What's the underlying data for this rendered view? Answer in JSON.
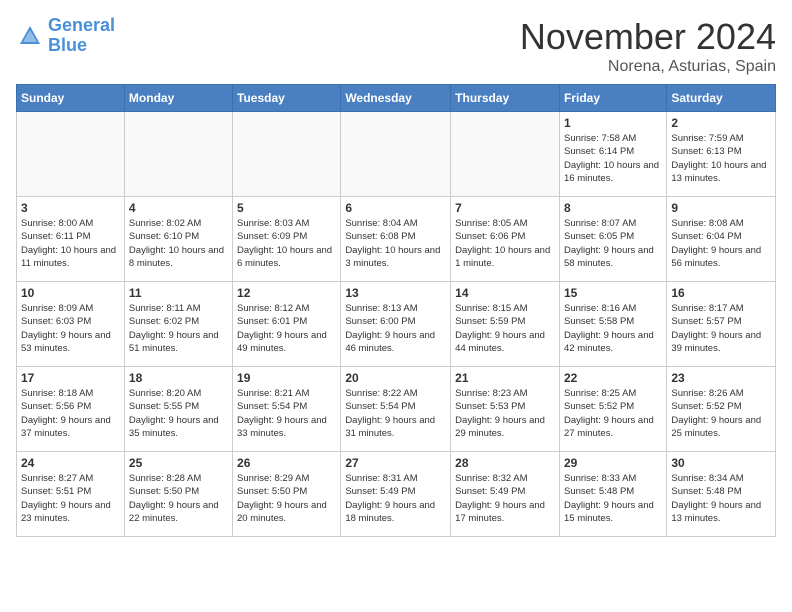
{
  "header": {
    "logo_line1": "General",
    "logo_line2": "Blue",
    "month_title": "November 2024",
    "location": "Norena, Asturias, Spain"
  },
  "weekdays": [
    "Sunday",
    "Monday",
    "Tuesday",
    "Wednesday",
    "Thursday",
    "Friday",
    "Saturday"
  ],
  "weeks": [
    [
      {
        "day": "",
        "info": ""
      },
      {
        "day": "",
        "info": ""
      },
      {
        "day": "",
        "info": ""
      },
      {
        "day": "",
        "info": ""
      },
      {
        "day": "",
        "info": ""
      },
      {
        "day": "1",
        "info": "Sunrise: 7:58 AM\nSunset: 6:14 PM\nDaylight: 10 hours and 16 minutes."
      },
      {
        "day": "2",
        "info": "Sunrise: 7:59 AM\nSunset: 6:13 PM\nDaylight: 10 hours and 13 minutes."
      }
    ],
    [
      {
        "day": "3",
        "info": "Sunrise: 8:00 AM\nSunset: 6:11 PM\nDaylight: 10 hours and 11 minutes."
      },
      {
        "day": "4",
        "info": "Sunrise: 8:02 AM\nSunset: 6:10 PM\nDaylight: 10 hours and 8 minutes."
      },
      {
        "day": "5",
        "info": "Sunrise: 8:03 AM\nSunset: 6:09 PM\nDaylight: 10 hours and 6 minutes."
      },
      {
        "day": "6",
        "info": "Sunrise: 8:04 AM\nSunset: 6:08 PM\nDaylight: 10 hours and 3 minutes."
      },
      {
        "day": "7",
        "info": "Sunrise: 8:05 AM\nSunset: 6:06 PM\nDaylight: 10 hours and 1 minute."
      },
      {
        "day": "8",
        "info": "Sunrise: 8:07 AM\nSunset: 6:05 PM\nDaylight: 9 hours and 58 minutes."
      },
      {
        "day": "9",
        "info": "Sunrise: 8:08 AM\nSunset: 6:04 PM\nDaylight: 9 hours and 56 minutes."
      }
    ],
    [
      {
        "day": "10",
        "info": "Sunrise: 8:09 AM\nSunset: 6:03 PM\nDaylight: 9 hours and 53 minutes."
      },
      {
        "day": "11",
        "info": "Sunrise: 8:11 AM\nSunset: 6:02 PM\nDaylight: 9 hours and 51 minutes."
      },
      {
        "day": "12",
        "info": "Sunrise: 8:12 AM\nSunset: 6:01 PM\nDaylight: 9 hours and 49 minutes."
      },
      {
        "day": "13",
        "info": "Sunrise: 8:13 AM\nSunset: 6:00 PM\nDaylight: 9 hours and 46 minutes."
      },
      {
        "day": "14",
        "info": "Sunrise: 8:15 AM\nSunset: 5:59 PM\nDaylight: 9 hours and 44 minutes."
      },
      {
        "day": "15",
        "info": "Sunrise: 8:16 AM\nSunset: 5:58 PM\nDaylight: 9 hours and 42 minutes."
      },
      {
        "day": "16",
        "info": "Sunrise: 8:17 AM\nSunset: 5:57 PM\nDaylight: 9 hours and 39 minutes."
      }
    ],
    [
      {
        "day": "17",
        "info": "Sunrise: 8:18 AM\nSunset: 5:56 PM\nDaylight: 9 hours and 37 minutes."
      },
      {
        "day": "18",
        "info": "Sunrise: 8:20 AM\nSunset: 5:55 PM\nDaylight: 9 hours and 35 minutes."
      },
      {
        "day": "19",
        "info": "Sunrise: 8:21 AM\nSunset: 5:54 PM\nDaylight: 9 hours and 33 minutes."
      },
      {
        "day": "20",
        "info": "Sunrise: 8:22 AM\nSunset: 5:54 PM\nDaylight: 9 hours and 31 minutes."
      },
      {
        "day": "21",
        "info": "Sunrise: 8:23 AM\nSunset: 5:53 PM\nDaylight: 9 hours and 29 minutes."
      },
      {
        "day": "22",
        "info": "Sunrise: 8:25 AM\nSunset: 5:52 PM\nDaylight: 9 hours and 27 minutes."
      },
      {
        "day": "23",
        "info": "Sunrise: 8:26 AM\nSunset: 5:52 PM\nDaylight: 9 hours and 25 minutes."
      }
    ],
    [
      {
        "day": "24",
        "info": "Sunrise: 8:27 AM\nSunset: 5:51 PM\nDaylight: 9 hours and 23 minutes."
      },
      {
        "day": "25",
        "info": "Sunrise: 8:28 AM\nSunset: 5:50 PM\nDaylight: 9 hours and 22 minutes."
      },
      {
        "day": "26",
        "info": "Sunrise: 8:29 AM\nSunset: 5:50 PM\nDaylight: 9 hours and 20 minutes."
      },
      {
        "day": "27",
        "info": "Sunrise: 8:31 AM\nSunset: 5:49 PM\nDaylight: 9 hours and 18 minutes."
      },
      {
        "day": "28",
        "info": "Sunrise: 8:32 AM\nSunset: 5:49 PM\nDaylight: 9 hours and 17 minutes."
      },
      {
        "day": "29",
        "info": "Sunrise: 8:33 AM\nSunset: 5:48 PM\nDaylight: 9 hours and 15 minutes."
      },
      {
        "day": "30",
        "info": "Sunrise: 8:34 AM\nSunset: 5:48 PM\nDaylight: 9 hours and 13 minutes."
      }
    ]
  ]
}
